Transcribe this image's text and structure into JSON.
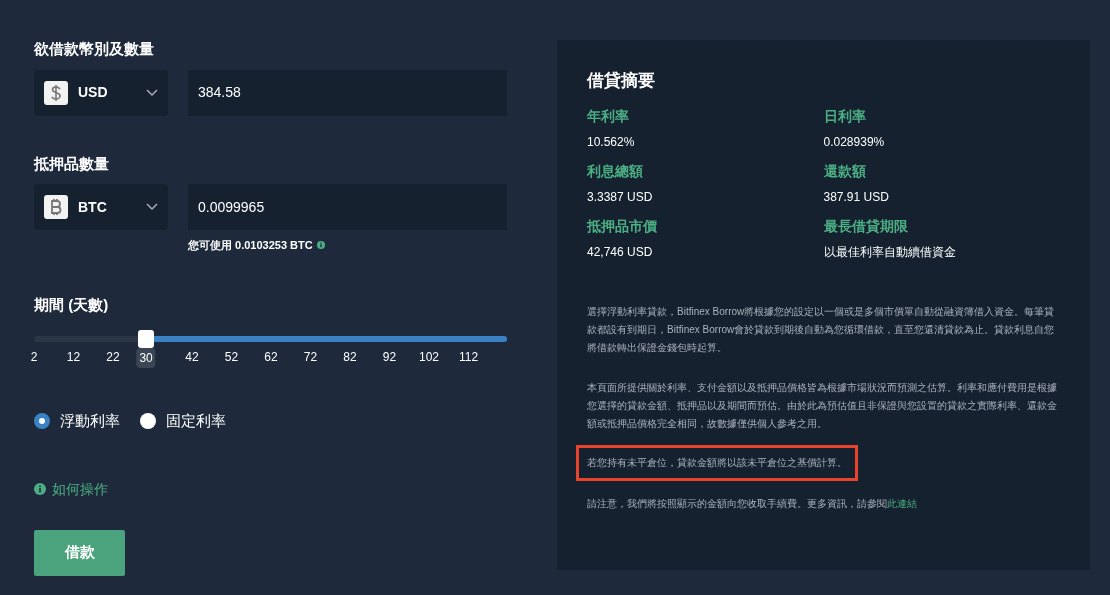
{
  "borrow": {
    "label": "欲借款幣別及數量",
    "currency": "USD",
    "kind": "dollar",
    "amount": "384.58"
  },
  "collateral": {
    "label": "抵押品數量",
    "currency": "BTC",
    "kind": "bitcoin",
    "amount": "0.0099965",
    "available": "您可使用 0.0103253 BTC"
  },
  "period": {
    "label": "期間 (天數)",
    "level": 0.237,
    "value": "30",
    "ticks": [
      "2",
      "12",
      "22",
      "42",
      "52",
      "62",
      "72",
      "82",
      "92",
      "102",
      "112"
    ]
  },
  "rate_types": [
    {
      "label": "浮動利率",
      "selected": true
    },
    {
      "label": "固定利率",
      "selected": false
    }
  ],
  "help_link": "如何操作",
  "borrow_button": "借款",
  "summary": {
    "title": "借貸摘要",
    "items": [
      {
        "label": "年利率",
        "value": "10.562%"
      },
      {
        "label": "日利率",
        "value": "0.028939%"
      },
      {
        "label": "利息總額",
        "value": "3.3387 USD"
      },
      {
        "label": "還款額",
        "value": "387.91 USD"
      },
      {
        "label": "抵押品市價",
        "value": "42,746 USD"
      },
      {
        "label": "最長借貸期限",
        "value": "以最佳利率自動續借資金"
      }
    ],
    "notes": [
      {
        "text": "選擇浮動利率貸款，Bitfinex Borrow將根據您的設定以一個或是多個市價單自動從融資簿借入資金。每筆貸款都設有到期日，Bitfinex Borrow會於貸款到期後自動為您循環借款，直至您還清貸款為止。貸款利息自您將借款轉出保證金錢包時起算。",
        "highlighted": false
      },
      {
        "text": "本頁面所提供關於利率、支付金額以及抵押品價格皆為根據市場狀況而預測之估算。利率和應付費用是根據您選擇的貸款金額、抵押品以及期間而預估。由於此為預估值且非保證與您設置的貸款之實際利率、還款金額或抵押品價格完全相同，故數據僅供個人參考之用。",
        "highlighted": false
      },
      {
        "text": "若您持有未平倉位，貸款金額將以該未平倉位之基價計算。",
        "highlighted": true
      },
      {
        "text": "請注意，我們將按照顯示的金額向您收取手續費。更多資訊，請參閱",
        "link": "此連結",
        "highlighted": false
      }
    ]
  }
}
